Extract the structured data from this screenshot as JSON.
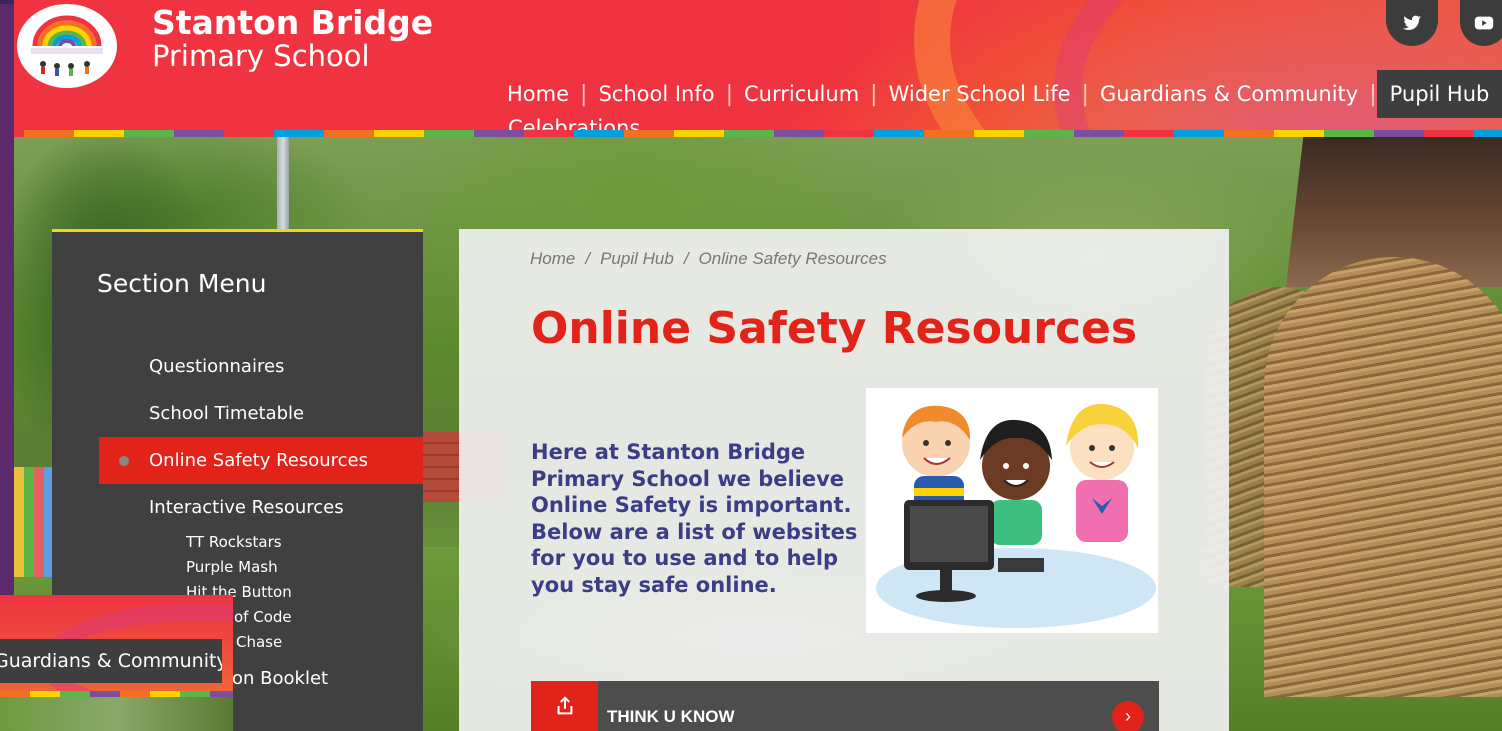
{
  "header": {
    "school_name_line1": "Stanton Bridge",
    "school_name_line2": "Primary School",
    "logo_icon": "rainbow-logo-icon"
  },
  "nav": {
    "items": [
      {
        "label": "Home"
      },
      {
        "label": "School Info"
      },
      {
        "label": "Curriculum"
      },
      {
        "label": "Wider School Life"
      },
      {
        "label": "Guardians & Community"
      },
      {
        "label": "Pupil Hub",
        "active": true
      }
    ],
    "overflow_label": "Celebrations"
  },
  "social": {
    "twitter_icon": "twitter-icon",
    "youtube_icon": "youtube-icon"
  },
  "section_menu": {
    "title": "Section Menu",
    "items": [
      {
        "label": "Questionnaires"
      },
      {
        "label": "School Timetable"
      },
      {
        "label": "Online Safety Resources",
        "active": true
      },
      {
        "label": "Interactive Resources"
      }
    ],
    "sub_items": [
      {
        "label": "TT Rockstars"
      },
      {
        "label": "Purple Mash"
      },
      {
        "label": "Hit the Button"
      },
      {
        "label": "of Code"
      },
      {
        "label": "Chase"
      }
    ],
    "partial_item": "on Booklet"
  },
  "overlay": {
    "label": "Guardians & Community"
  },
  "breadcrumb": {
    "items": [
      "Home",
      "Pupil Hub",
      "Online Safety Resources"
    ],
    "separator": "/"
  },
  "page": {
    "title": "Online Safety Resources",
    "intro": "Here at Stanton Bridge Primary School we believe Online Safety is important. Below are a list of websites for you to use and to help you stay safe online."
  },
  "resource_links": [
    {
      "label": "THINK U KNOW",
      "icon": "external-link-icon",
      "arrow_icon": "chevron-right-icon"
    }
  ],
  "colors": {
    "brand_red": "#ef3340",
    "accent_red": "#e2231a",
    "menu_bg": "#404040",
    "intro_text": "#3b3d86",
    "menu_border": "#f2d41e"
  }
}
